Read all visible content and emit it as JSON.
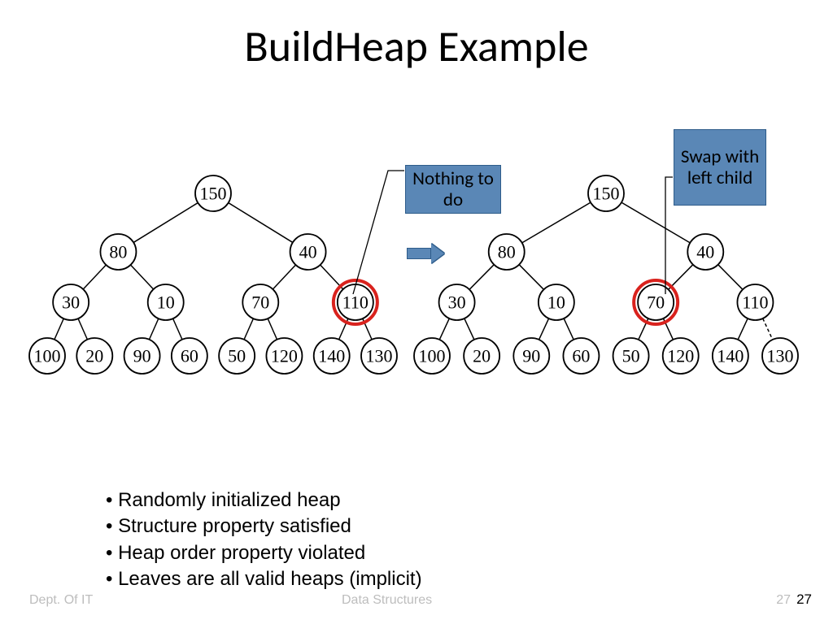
{
  "title": "BuildHeap Example",
  "callouts": {
    "nothing": "Nothing to do",
    "swap": "Swap with left child"
  },
  "trees": {
    "left": {
      "l0": [
        "150"
      ],
      "l1": [
        "80",
        "40"
      ],
      "l2": [
        "30",
        "10",
        "70",
        "110"
      ],
      "l3": [
        "100",
        "20",
        "90",
        "60",
        "50",
        "120",
        "140",
        "130"
      ],
      "highlight_index": 3
    },
    "right": {
      "l0": [
        "150"
      ],
      "l1": [
        "80",
        "40"
      ],
      "l2": [
        "30",
        "10",
        "70",
        "110"
      ],
      "l3": [
        "100",
        "20",
        "90",
        "60",
        "50",
        "120",
        "140",
        "130"
      ],
      "highlight_index": 2,
      "dashed_leaf_index": 7
    }
  },
  "bullets": [
    "Randomly initialized heap",
    "Structure property satisfied",
    "Heap order property violated",
    "Leaves are all valid heaps (implicit)"
  ],
  "footer": {
    "dept": "Dept. Of  IT",
    "mid": "Data Structures",
    "page_grey": "27",
    "page_dark": "27"
  }
}
